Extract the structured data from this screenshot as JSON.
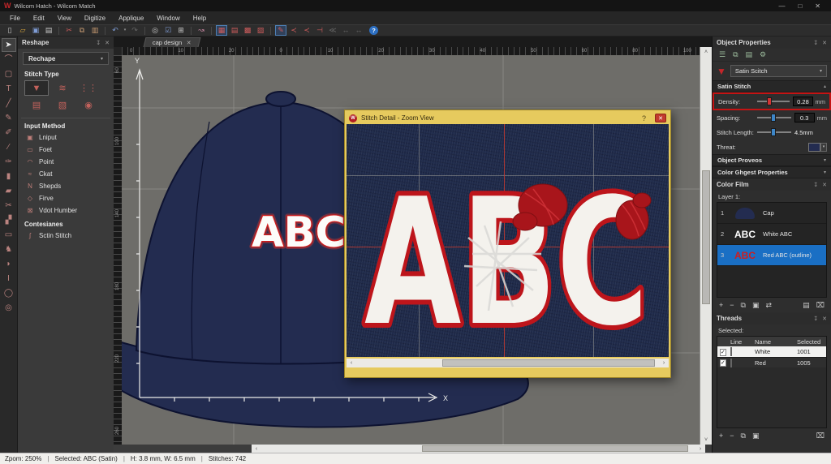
{
  "colors": {
    "accent_red": "#c4262a",
    "gold_titlebar": "#e6ca5e",
    "cap_navy": "#232c50",
    "fabric_navy": "#1f2a4a",
    "selection_blue": "#1a6fc4",
    "canvas_gray": "#6e6d69",
    "density_highlight": "#c41414",
    "thread_white": "#ffffff",
    "thread_red": "#e00007"
  },
  "titlebar": {
    "logo": "W",
    "title": "Wilcom Hatch - Wilcom Match",
    "minimize": "—",
    "maximize": "□",
    "close": "✕"
  },
  "menubar": {
    "items": [
      "File",
      "Edit",
      "View",
      "Digitize",
      "Applique",
      "Window",
      "Help"
    ]
  },
  "toolbar": {
    "icons": [
      "▯",
      "▱",
      "▣",
      "▤",
      "✂",
      "⧉",
      "▥",
      "↶",
      "▾",
      "↷",
      "◎",
      "☑",
      "⊞",
      "↝",
      "▦",
      "▤",
      "▩",
      "▨",
      "✎",
      "≺",
      "≺",
      "⊣",
      "≪",
      "↔",
      "↔",
      "?"
    ]
  },
  "left_toolbar": {
    "icons": [
      "➤",
      "⌒",
      "▢",
      "T",
      "╱",
      "✎",
      "✐",
      "∕",
      "✑",
      "▮",
      "▰",
      "✂",
      "▞",
      "▭",
      "♞",
      "◗",
      "I",
      "◯",
      "◎"
    ]
  },
  "reshape_panel": {
    "title": "Reshape",
    "pin": "↧",
    "close": "✕",
    "dropdown_label": "Rechape",
    "dropdown_chevron": "▾",
    "stitch_type_label": "Stitch Type",
    "stitch_type_icons": [
      "▼",
      "≋",
      "⋮⋮",
      "▤",
      "▧",
      "◉"
    ],
    "input_method_label": "Input Method",
    "input_items": [
      {
        "icon": "▣",
        "label": "Lniput"
      },
      {
        "icon": "▭",
        "label": "Foet"
      },
      {
        "icon": "◠",
        "label": "Point"
      },
      {
        "icon": "≈",
        "label": "Ckat"
      },
      {
        "icon": "N",
        "label": "Shepds"
      },
      {
        "icon": "◇",
        "label": "Firve"
      },
      {
        "icon": "⊠",
        "label": "Vdot Humber"
      }
    ],
    "contesianes_label": "Contesianes",
    "contesianes_item": {
      "icon": "ʃ",
      "label": "Sctin Stitch"
    }
  },
  "tabbar": {
    "tab_label": "cap design",
    "tab_close": "✕"
  },
  "canvas": {
    "ruler_top_labels": [
      "0",
      "10",
      "20",
      "0",
      "10",
      "20",
      "30",
      "40",
      "50",
      "60",
      "80",
      "100"
    ],
    "ruler_left_labels": [
      "60",
      "100",
      "140",
      "180",
      "220",
      "260"
    ],
    "y_axis_label": "Y",
    "x_axis_label": "X",
    "cap_text": "ABC"
  },
  "zoom_window": {
    "logo": "W",
    "title": "Stitch Detail - Zoom View",
    "help": "?",
    "close": "✕",
    "abc_text": "ABC",
    "scroll_left": "‹",
    "scroll_right": "›"
  },
  "scrollbars": {
    "up": "˄",
    "down": "˅",
    "left": "‹",
    "right": "›"
  },
  "object_properties": {
    "title": "Object Properties",
    "pin": "↧",
    "close": "✕",
    "toolbar_icons": [
      "☰",
      "⧉",
      "▤",
      "⚙"
    ],
    "stitch_glyph": "▼",
    "stitch_select": {
      "value": "Satin Scitch",
      "chevron": "▾"
    },
    "section_satin": {
      "label": "Satin Stitch",
      "chevron": "▴"
    },
    "density": {
      "label": "Density:",
      "value": "0.28",
      "unit": "mm"
    },
    "spacing": {
      "label": "Spacing:",
      "value": "0.3",
      "unit": "mm"
    },
    "stitch_length": {
      "label": "Stitch Length:",
      "value": "4.5mm"
    },
    "thread": {
      "label": "Threat:",
      "chevron": "▾"
    },
    "section_previews": {
      "label": "Object Proveos",
      "chevron": "▾"
    },
    "section_color": {
      "label": "Color Ghgest Properties",
      "chevron": "▾"
    }
  },
  "color_film": {
    "title": "Color Film",
    "pin": "↧",
    "close": "✕",
    "layer_label": "Layer 1:",
    "rows": [
      {
        "num": "1",
        "label": "Cap"
      },
      {
        "num": "2",
        "thumb": "ABC",
        "label": "White ABC"
      },
      {
        "num": "3",
        "thumb": "ABC",
        "label": "Red ABC (outline)"
      }
    ],
    "tools_left": [
      "+",
      "−",
      "⧉",
      "▣",
      "⇄"
    ],
    "tools_right": [
      "▤",
      "⌧"
    ]
  },
  "threads": {
    "title": "Threads",
    "pin": "↧",
    "close": "✕",
    "selected_label": "Selected:",
    "columns": [
      "Line",
      "Name",
      "Selected"
    ],
    "rows": [
      {
        "check": "✓",
        "name": "White",
        "code": "1001",
        "color": "#ffffff"
      },
      {
        "check": "✓",
        "name": "Red",
        "code": "1005",
        "color": "#e00007"
      }
    ],
    "tools_left": [
      "+",
      "−",
      "⧉",
      "▣"
    ],
    "tools_right": [
      "⌧"
    ]
  },
  "statusbar": {
    "zoom": "Zpom: 250%",
    "separator": "|",
    "selected": "Selected: ABC (Satin)",
    "size": "H: 3.8 mm, W: 6.5 mm",
    "stitches": "Stitches: 742"
  }
}
